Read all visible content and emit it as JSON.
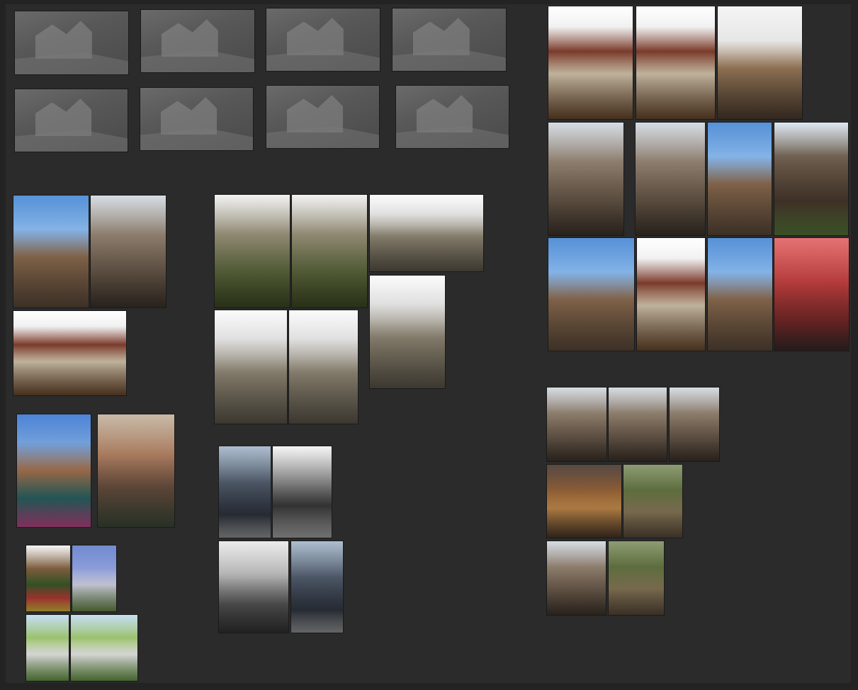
{
  "board": {
    "background": "#2b2b2b",
    "tile_border": "#1a1a1a"
  },
  "groups": {
    "blockouts": {
      "label": "",
      "kind": "grayscale 3D blockout renders",
      "count": 8
    },
    "town_streets": {
      "label": "",
      "kind": "half-timbered town street photos",
      "count": 3
    },
    "ruins": {
      "label": "",
      "kind": "gothic abbey ruin photos",
      "count": 6
    },
    "canals": {
      "label": "",
      "kind": "canal and bridge photos",
      "count": 2
    },
    "fountains": {
      "label": "",
      "kind": "fountain photos",
      "count": 4
    },
    "cathedrals": {
      "label": "",
      "kind": "gothic cathedral photos",
      "count": 4
    },
    "timber_houses": {
      "label": "",
      "kind": "half-timbered house photos",
      "count": 11
    },
    "alleys": {
      "label": "",
      "kind": "narrow alley photos",
      "count": 7
    }
  }
}
